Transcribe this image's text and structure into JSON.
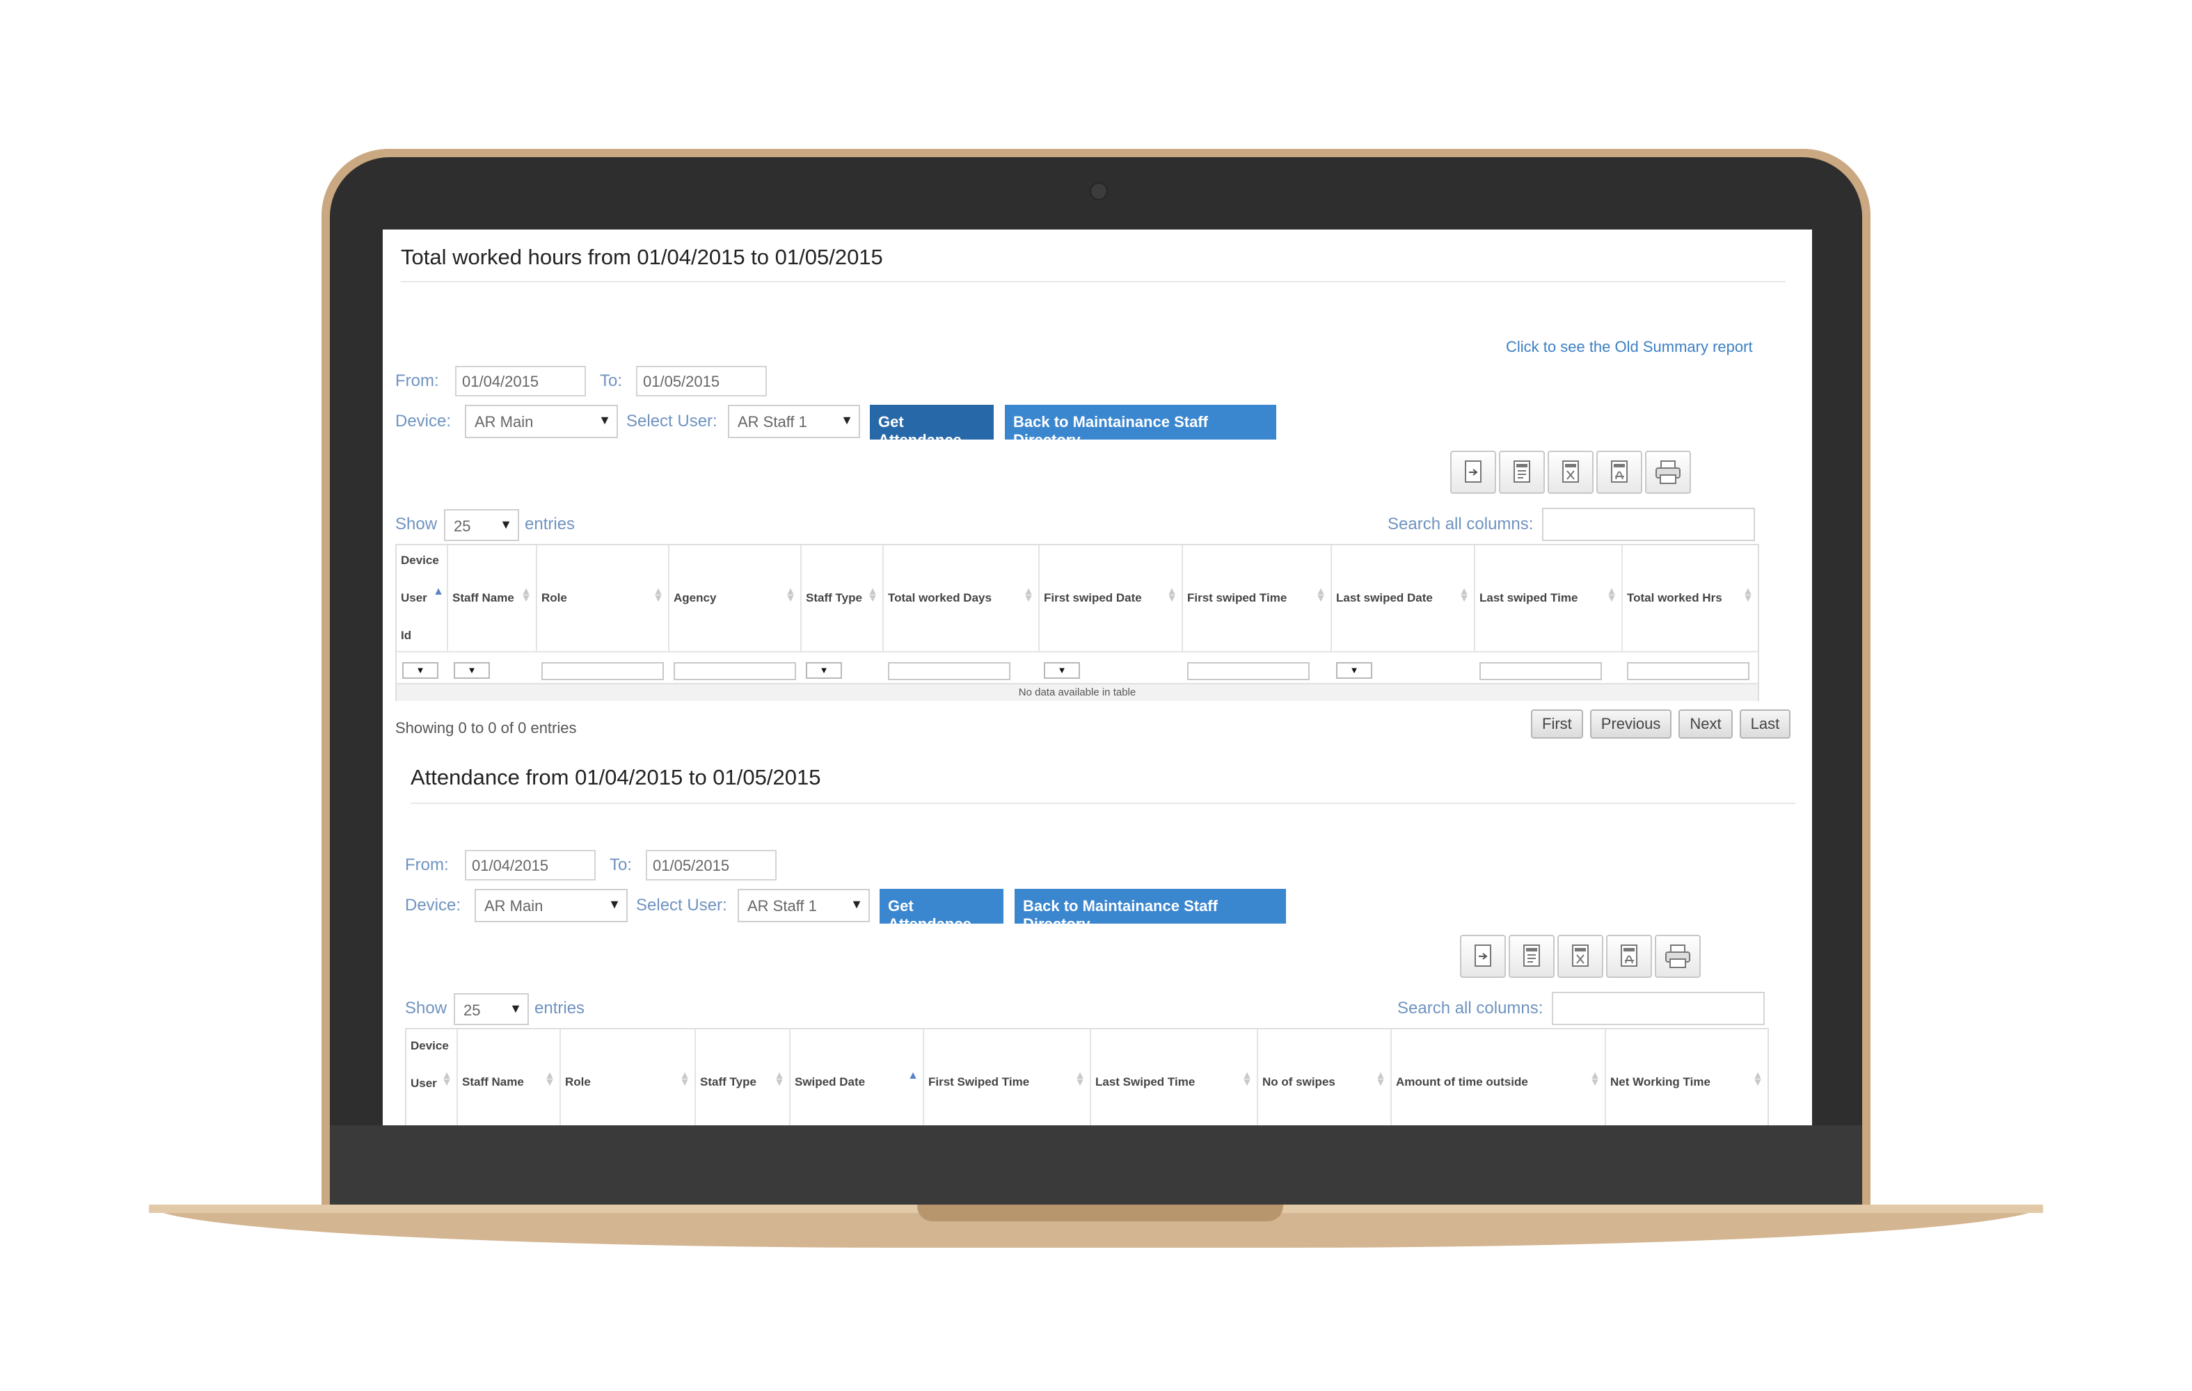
{
  "report1": {
    "title": "Total worked hours from 01/04/2015 to 01/05/2015",
    "old_summary_link": "Click to see the Old Summary report",
    "from_label": "From:",
    "from_value": "01/04/2015",
    "to_label": "To:",
    "to_value": "01/05/2015",
    "device_label": "Device:",
    "device_value": "AR Main",
    "select_user_label": "Select User:",
    "select_user_value": "AR Staff 1",
    "get_attendance": "Get Attendance",
    "back_button": "Back to Maintainance Staff Directory",
    "show_label": "Show",
    "show_value": "25",
    "entries_label": "entries",
    "search_label": "Search all columns:",
    "columns": [
      "Device User Id",
      "Staff Name",
      "Role",
      "Agency",
      "Staff Type",
      "Total worked Days",
      "First swiped Date",
      "First swiped Time",
      "Last swiped Date",
      "Last swiped Time",
      "Total worked Hrs"
    ],
    "col_device_line1": "Device",
    "col_device_line2": "User",
    "col_device_line3": "Id",
    "empty_message": "No data available in table",
    "info": "Showing 0 to 0 of 0 entries",
    "pager": [
      "First",
      "Previous",
      "Next",
      "Last"
    ]
  },
  "report2": {
    "title": "Attendance from 01/04/2015 to 01/05/2015",
    "from_label": "From:",
    "from_value": "01/04/2015",
    "to_label": "To:",
    "to_value": "01/05/2015",
    "device_label": "Device:",
    "device_value": "AR Main",
    "select_user_label": "Select User:",
    "select_user_value": "AR Staff 1",
    "get_attendance": "Get Attendance",
    "back_button": "Back to Maintainance Staff Directory",
    "show_label": "Show",
    "show_value": "25",
    "entries_label": "entries",
    "search_label": "Search all columns:",
    "columns": [
      "Device User Id",
      "Staff Name",
      "Role",
      "Staff Type",
      "Swiped Date",
      "First Swiped Time",
      "Last Swiped Time",
      "No of swipes",
      "Amount of time outside",
      "Net Working Time"
    ],
    "col_device_line1": "Device",
    "col_device_line2": "User"
  },
  "toolbar_icons": [
    "copy-icon",
    "csv-icon",
    "excel-icon",
    "pdf-icon",
    "print-icon"
  ],
  "colors": {
    "label_blue": "#6f93c0",
    "button_dark": "#2768a8",
    "button_light": "#3a86cf",
    "link": "#3b7fc4",
    "laptop_frame": "#caa881"
  }
}
